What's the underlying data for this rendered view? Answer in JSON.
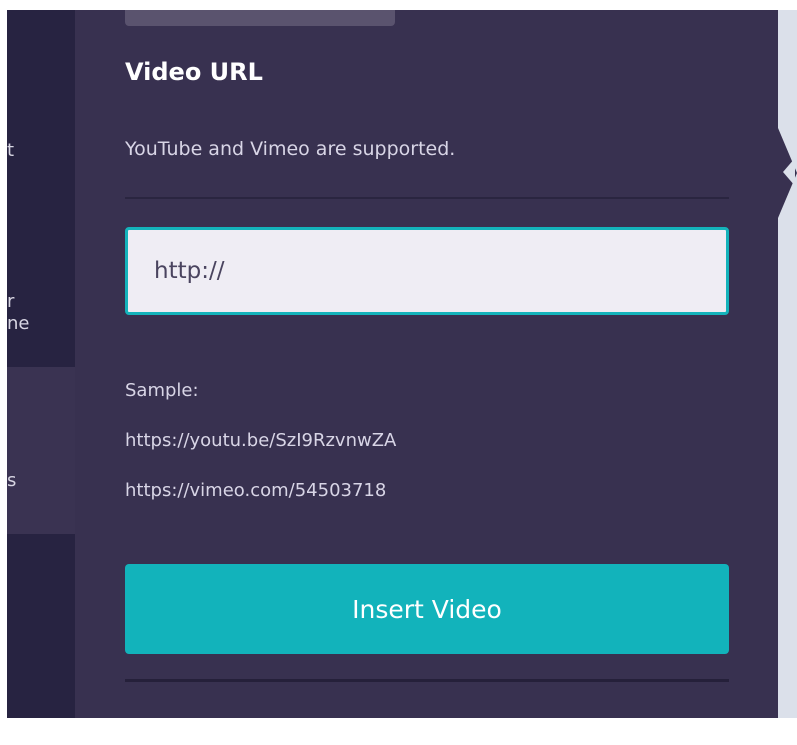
{
  "left_nav": {
    "fragments": [
      "t",
      "r",
      "ne",
      "s"
    ]
  },
  "video_panel": {
    "title": "Video URL",
    "subtitle": "YouTube and Vimeo are supported.",
    "url_input": {
      "placeholder": "http://",
      "value": ""
    },
    "samples": [
      "Sample:",
      "https://youtu.be/SzI9RzvnwZA",
      "https://vimeo.com/54503718"
    ],
    "insert_button_label": "Insert Video"
  },
  "colors": {
    "panel_bg": "#383150",
    "nav_bg": "#272341",
    "accent": "#12b3bb",
    "input_bg": "#efedf4",
    "text_primary": "#ffffff",
    "text_secondary": "#d8d5e6"
  }
}
